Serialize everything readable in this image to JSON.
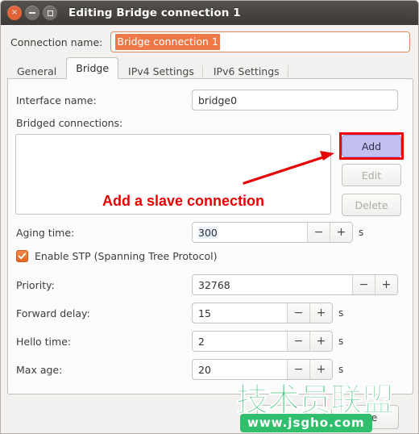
{
  "window": {
    "title": "Editing Bridge connection 1",
    "buttons": {
      "close": "close-button",
      "minimize": "minimize-button",
      "maximize": "maximize-button"
    }
  },
  "connection": {
    "label": "Connection name:",
    "value": "Bridge connection 1"
  },
  "tabs": [
    {
      "label": "General",
      "active": false
    },
    {
      "label": "Bridge",
      "active": true
    },
    {
      "label": "IPv4 Settings",
      "active": false
    },
    {
      "label": "IPv6 Settings",
      "active": false
    }
  ],
  "bridge": {
    "interface_name": {
      "label": "Interface name:",
      "value": "bridge0"
    },
    "bridged_connections": {
      "label": "Bridged connections:",
      "items": []
    },
    "list_buttons": [
      {
        "label": "Add",
        "enabled": true,
        "highlighted": true
      },
      {
        "label": "Edit",
        "enabled": false,
        "highlighted": false
      },
      {
        "label": "Delete",
        "enabled": false,
        "highlighted": false
      }
    ],
    "aging_time": {
      "label": "Aging time:",
      "value": "300",
      "unit": "s"
    },
    "stp": {
      "label": "Enable STP (Spanning Tree Protocol)",
      "checked": true
    },
    "priority": {
      "label": "Priority:",
      "value": "32768",
      "unit": ""
    },
    "forward_delay": {
      "label": "Forward delay:",
      "value": "15",
      "unit": "s"
    },
    "hello_time": {
      "label": "Hello time:",
      "value": "2",
      "unit": "s"
    },
    "max_age": {
      "label": "Max age:",
      "value": "20",
      "unit": "s"
    }
  },
  "footer": {
    "save_label": "Save",
    "cancel_label": "Cancel"
  },
  "annotation": {
    "text": "Add a slave connection",
    "color": "#e60000"
  },
  "watermark": {
    "brand": "技术员联盟",
    "url": "www.jsgho.com",
    "color": "#2fbf6d"
  },
  "icons": {
    "minus": "−",
    "plus": "+",
    "close": "×"
  },
  "colors": {
    "accent": "#f07746",
    "titlebar": "#474440",
    "highlight_box": "#ee0000",
    "add_fill": "#c3c0ef"
  }
}
